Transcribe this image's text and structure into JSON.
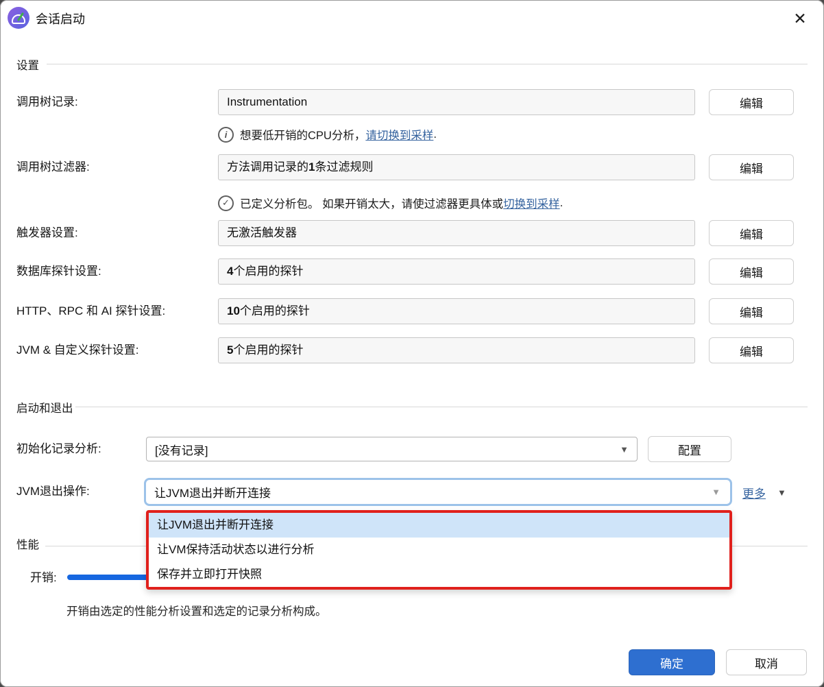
{
  "window": {
    "title": "会话启动",
    "close_icon": "✕"
  },
  "sections": {
    "settings": "设置",
    "startup": "启动和退出",
    "performance": "性能"
  },
  "settings_rows": [
    {
      "label": "调用树记录:",
      "value_pre": "Instrumentation",
      "value_bold": "",
      "value_post": "",
      "button": "编辑"
    },
    {
      "label": "调用树过滤器:",
      "value_pre": "方法调用记录的",
      "value_bold": "1",
      "value_post": "条过滤规则",
      "button": "编辑"
    },
    {
      "label": "触发器设置:",
      "value_pre": "无激活触发器",
      "value_bold": "",
      "value_post": "",
      "button": "编辑"
    },
    {
      "label": "数据库探针设置:",
      "value_pre": "",
      "value_bold": "4",
      "value_post": "个启用的探针",
      "button": "编辑"
    },
    {
      "label": "HTTP、RPC 和 AI 探针设置:",
      "value_pre": "",
      "value_bold": "10",
      "value_post": "个启用的探针",
      "button": "编辑"
    },
    {
      "label": "JVM & 自定义探针设置:",
      "value_pre": "",
      "value_bold": "5",
      "value_post": "个启用的探针",
      "button": "编辑"
    }
  ],
  "notes": {
    "info": {
      "icon": "i",
      "text_pre": "想要低开销的CPU分析， ",
      "link": "请切换到采样",
      "text_post": "."
    },
    "check": {
      "icon": "✓",
      "text_pre": "已定义分析包。 如果开销太大，请使过滤器更具体或 ",
      "link": "切换到采样",
      "text_post": "."
    }
  },
  "startup_rows": {
    "initial": {
      "label": "初始化记录分析:",
      "value": "[没有记录]",
      "button": "配置",
      "arrow": "▼"
    },
    "jvm_exit": {
      "label": "JVM退出操作:",
      "value": "让JVM退出并断开连接",
      "more_label": "更多",
      "more_caret": "▼",
      "arrow": "▼"
    }
  },
  "dropdown": {
    "items": [
      {
        "label": "让JVM退出并断开连接"
      },
      {
        "label": "让VM保持活动状态以进行分析"
      },
      {
        "label": "保存并立即打开快照"
      }
    ]
  },
  "performance": {
    "overhead_label": "开销:",
    "note": "开销由选定的性能分析设置和选定的记录分析构成。"
  },
  "footer": {
    "ok": "确定",
    "cancel": "取消"
  },
  "colors": {
    "accent_blue": "#2e6fd0",
    "selection_blue": "#cfe4f9",
    "focus_ring": "#9cc2e9",
    "annotation_red": "#e0201c",
    "link_blue": "#35639f",
    "slider_blue": "#1667e0"
  }
}
